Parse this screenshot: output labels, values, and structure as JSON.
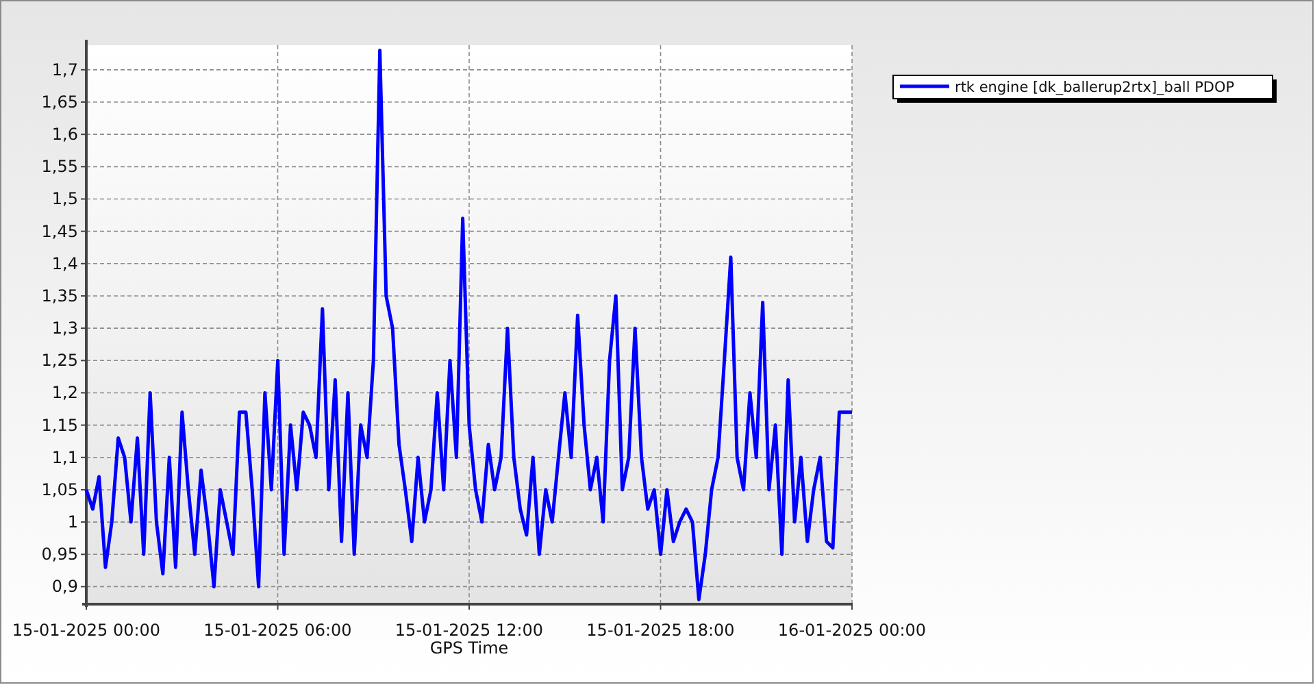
{
  "chart": {
    "chart_data": {
      "type": "line",
      "xlabel": "GPS Time",
      "grid": true,
      "ylim": [
        0.875,
        1.738
      ],
      "yticks": [
        {
          "value": 0.9,
          "label": "0,9"
        },
        {
          "value": 0.95,
          "label": "0,95"
        },
        {
          "value": 1,
          "label": "1"
        },
        {
          "value": 1.05,
          "label": "1,05"
        },
        {
          "value": 1.1,
          "label": "1,1"
        },
        {
          "value": 1.15,
          "label": "1,15"
        },
        {
          "value": 1.2,
          "label": "1,2"
        },
        {
          "value": 1.25,
          "label": "1,25"
        },
        {
          "value": 1.3,
          "label": "1,3"
        },
        {
          "value": 1.35,
          "label": "1,35"
        },
        {
          "value": 1.4,
          "label": "1,4"
        },
        {
          "value": 1.45,
          "label": "1,45"
        },
        {
          "value": 1.5,
          "label": "1,5"
        },
        {
          "value": 1.55,
          "label": "1,55"
        },
        {
          "value": 1.6,
          "label": "1,6"
        },
        {
          "value": 1.65,
          "label": "1,65"
        },
        {
          "value": 1.7,
          "label": "1,7"
        }
      ],
      "categories": [
        "15-01-2025 00:00",
        null,
        null,
        null,
        null,
        null,
        null,
        null,
        null,
        null,
        null,
        null,
        null,
        null,
        null,
        null,
        null,
        null,
        null,
        null,
        null,
        null,
        null,
        null,
        null,
        null,
        null,
        null,
        null,
        null,
        "15-01-2025 06:00",
        null,
        null,
        null,
        null,
        null,
        null,
        null,
        null,
        null,
        null,
        null,
        null,
        null,
        null,
        null,
        null,
        null,
        null,
        null,
        null,
        null,
        null,
        null,
        null,
        null,
        null,
        null,
        null,
        null,
        "15-01-2025 12:00",
        null,
        null,
        null,
        null,
        null,
        null,
        null,
        null,
        null,
        null,
        null,
        null,
        null,
        null,
        null,
        null,
        null,
        null,
        null,
        null,
        null,
        null,
        null,
        null,
        null,
        null,
        null,
        null,
        null,
        "15-01-2025 18:00",
        null,
        null,
        null,
        null,
        null,
        null,
        null,
        null,
        null,
        null,
        null,
        null,
        null,
        null,
        null,
        null,
        null,
        null,
        null,
        null,
        null,
        null,
        null,
        null,
        null,
        null,
        null,
        null,
        null,
        "16-01-2025 00:00"
      ],
      "series": [
        {
          "name": "rtk engine [dk_ballerup2rtx]_ball PDOP",
          "color": "#0000ff",
          "values": [
            1.05,
            1.02,
            1.07,
            0.93,
            1.0,
            1.13,
            1.1,
            1.0,
            1.13,
            0.95,
            1.2,
            1.0,
            0.92,
            1.1,
            0.93,
            1.17,
            1.05,
            0.95,
            1.08,
            1.0,
            0.9,
            1.05,
            1.0,
            0.95,
            1.17,
            1.17,
            1.05,
            0.9,
            1.2,
            1.05,
            1.25,
            0.95,
            1.15,
            1.05,
            1.17,
            1.15,
            1.1,
            1.33,
            1.05,
            1.22,
            0.97,
            1.2,
            0.95,
            1.15,
            1.1,
            1.25,
            1.73,
            1.35,
            1.3,
            1.12,
            1.05,
            0.97,
            1.1,
            1.0,
            1.05,
            1.2,
            1.05,
            1.25,
            1.1,
            1.47,
            1.15,
            1.05,
            1.0,
            1.12,
            1.05,
            1.1,
            1.3,
            1.1,
            1.02,
            0.98,
            1.1,
            0.95,
            1.05,
            1.0,
            1.1,
            1.2,
            1.1,
            1.32,
            1.15,
            1.05,
            1.1,
            1.0,
            1.25,
            1.35,
            1.05,
            1.1,
            1.3,
            1.1,
            1.02,
            1.05,
            0.95,
            1.05,
            0.97,
            1.0,
            1.02,
            1.0,
            0.88,
            0.95,
            1.05,
            1.1,
            1.25,
            1.41,
            1.1,
            1.05,
            1.2,
            1.1,
            1.34,
            1.05,
            1.15,
            0.95,
            1.22,
            1.0,
            1.1,
            0.97,
            1.05,
            1.1,
            0.97,
            0.96,
            1.17,
            1.17,
            1.17
          ]
        }
      ]
    }
  }
}
